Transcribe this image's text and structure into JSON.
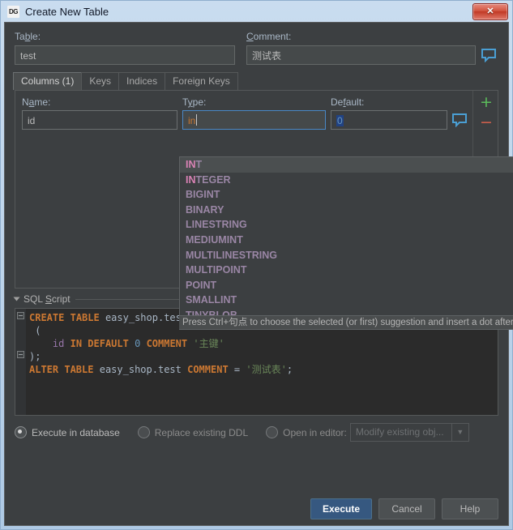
{
  "window": {
    "app_icon": "datagrip-icon",
    "app_icon_text": "DG",
    "title": "Create New Table",
    "close_label": "✕"
  },
  "form": {
    "table_label": "Table:",
    "table_label_pre": "Ta",
    "table_label_mn": "b",
    "table_label_post": "le:",
    "table_value": "test",
    "comment_label": "Comment:",
    "comment_label_mn": "C",
    "comment_label_post": "omment:",
    "comment_value": "测试表",
    "comment_icon": "speech-bubble-icon"
  },
  "tabs": [
    {
      "label": "Columns (1)",
      "active": true
    },
    {
      "label": "Keys",
      "active": false
    },
    {
      "label": "Indices",
      "active": false
    },
    {
      "label": "Foreign Keys",
      "active": false
    }
  ],
  "columns_editor": {
    "headers": {
      "name_pre": "N",
      "name_mn": "a",
      "name_post": "me:",
      "type_pre": "T",
      "type_mn": "y",
      "type_post": "pe:",
      "default_pre": "De",
      "default_mn": "f",
      "default_post": "ault:"
    },
    "row": {
      "name": "id",
      "type": "in",
      "default": "0",
      "default_icon": "speech-bubble-icon"
    },
    "add_button": "+",
    "remove_button": "−"
  },
  "autocomplete": {
    "typed_prefix": "IN",
    "items": [
      {
        "match": "IN",
        "rest": "T",
        "selected": true
      },
      {
        "match": "IN",
        "rest": "TEGER",
        "selected": false
      },
      {
        "match": "",
        "rest": "BIGINT",
        "selected": false
      },
      {
        "match": "",
        "rest": "BINARY",
        "selected": false
      },
      {
        "match": "",
        "rest": "LINESTRING",
        "selected": false
      },
      {
        "match": "",
        "rest": "MEDIUMINT",
        "selected": false
      },
      {
        "match": "",
        "rest": "MULTILINESTRING",
        "selected": false
      },
      {
        "match": "",
        "rest": "MULTIPOINT",
        "selected": false
      },
      {
        "match": "",
        "rest": "POINT",
        "selected": false
      },
      {
        "match": "",
        "rest": "SMALLINT",
        "selected": false
      },
      {
        "match": "",
        "rest": "TINYBLOB",
        "selected": false
      }
    ],
    "hint": "Press Ctrl+句点 to choose the selected (or first) suggestion and insert a dot afterwards"
  },
  "sql_section": {
    "title_pre": "SQL ",
    "title_mn": "S",
    "title_post": "cript",
    "lines": [
      {
        "tokens": [
          {
            "t": "CREATE",
            "c": "k"
          },
          {
            "t": " ",
            "c": "pun"
          },
          {
            "t": "TABLE",
            "c": "k"
          },
          {
            "t": " ",
            "c": "pun"
          },
          {
            "t": "easy_shop.test",
            "c": "id2"
          }
        ]
      },
      {
        "tokens": [
          {
            "t": " (",
            "c": "pun"
          }
        ]
      },
      {
        "tokens": [
          {
            "t": "    ",
            "c": "pun"
          },
          {
            "t": "id",
            "c": "fld"
          },
          {
            "t": " ",
            "c": "pun"
          },
          {
            "t": "IN",
            "c": "k"
          },
          {
            "t": " ",
            "c": "pun"
          },
          {
            "t": "DEFAULT",
            "c": "k"
          },
          {
            "t": " ",
            "c": "pun"
          },
          {
            "t": "0",
            "c": "num"
          },
          {
            "t": " ",
            "c": "pun"
          },
          {
            "t": "COMMENT",
            "c": "k"
          },
          {
            "t": " ",
            "c": "pun"
          },
          {
            "t": "'主键'",
            "c": "str"
          }
        ]
      },
      {
        "tokens": [
          {
            "t": ");",
            "c": "pun"
          }
        ]
      },
      {
        "tokens": [
          {
            "t": "ALTER",
            "c": "k"
          },
          {
            "t": " ",
            "c": "pun"
          },
          {
            "t": "TABLE",
            "c": "k"
          },
          {
            "t": " ",
            "c": "pun"
          },
          {
            "t": "easy_shop.test",
            "c": "id2"
          },
          {
            "t": " ",
            "c": "pun"
          },
          {
            "t": "COMMENT",
            "c": "k"
          },
          {
            "t": " = ",
            "c": "pun"
          },
          {
            "t": "'测试表'",
            "c": "str"
          },
          {
            "t": ";",
            "c": "pun"
          }
        ]
      }
    ]
  },
  "options": {
    "radios": [
      {
        "label": "Execute in database",
        "selected": true,
        "enabled": true
      },
      {
        "label": "Replace existing DDL",
        "selected": false,
        "enabled": false
      },
      {
        "label": "Open in editor:",
        "selected": false,
        "enabled": false
      }
    ],
    "editor_combo_value": "Modify existing obj...",
    "editor_combo_arrow": "▼"
  },
  "footer": {
    "execute": "Execute",
    "cancel": "Cancel",
    "help": "Help"
  },
  "colors": {
    "accent": "#365880",
    "keyword": "#cc7832",
    "string": "#6a8759",
    "number": "#6897bb",
    "field": "#9876aa",
    "match": "#d982b5",
    "add": "#5bbc5b",
    "remove": "#d1604d"
  }
}
